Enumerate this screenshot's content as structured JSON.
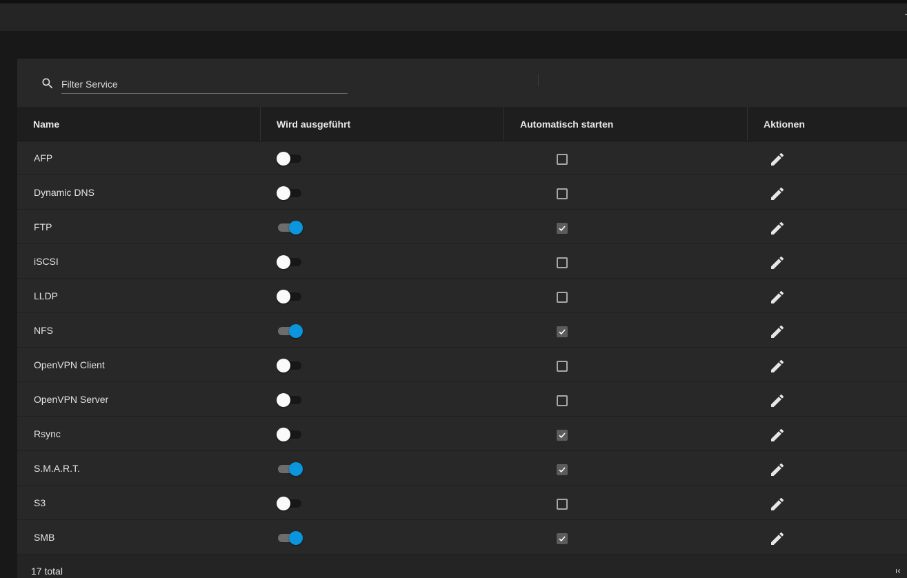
{
  "filter": {
    "placeholder": "Filter Service"
  },
  "table": {
    "columns": [
      "Name",
      "Wird ausgeführt",
      "Automatisch starten",
      "Aktionen"
    ],
    "rows": [
      {
        "name": "AFP",
        "running": false,
        "autostart": false
      },
      {
        "name": "Dynamic DNS",
        "running": false,
        "autostart": false
      },
      {
        "name": "FTP",
        "running": true,
        "autostart": true
      },
      {
        "name": "iSCSI",
        "running": false,
        "autostart": false
      },
      {
        "name": "LLDP",
        "running": false,
        "autostart": false
      },
      {
        "name": "NFS",
        "running": true,
        "autostart": true
      },
      {
        "name": "OpenVPN Client",
        "running": false,
        "autostart": false
      },
      {
        "name": "OpenVPN Server",
        "running": false,
        "autostart": false
      },
      {
        "name": "Rsync",
        "running": false,
        "autostart": true
      },
      {
        "name": "S.M.A.R.T.",
        "running": true,
        "autostart": true
      },
      {
        "name": "S3",
        "running": false,
        "autostart": false
      },
      {
        "name": "SMB",
        "running": true,
        "autostart": true
      }
    ]
  },
  "footer": {
    "total": "17 total"
  },
  "icons": {
    "search": "search-icon",
    "edit": "pencil-icon",
    "checkmark": "check-icon",
    "first_page": "first-page-icon"
  },
  "colors": {
    "toggle_on": "#0a95dc",
    "background": "#181818",
    "card": "#282828"
  }
}
